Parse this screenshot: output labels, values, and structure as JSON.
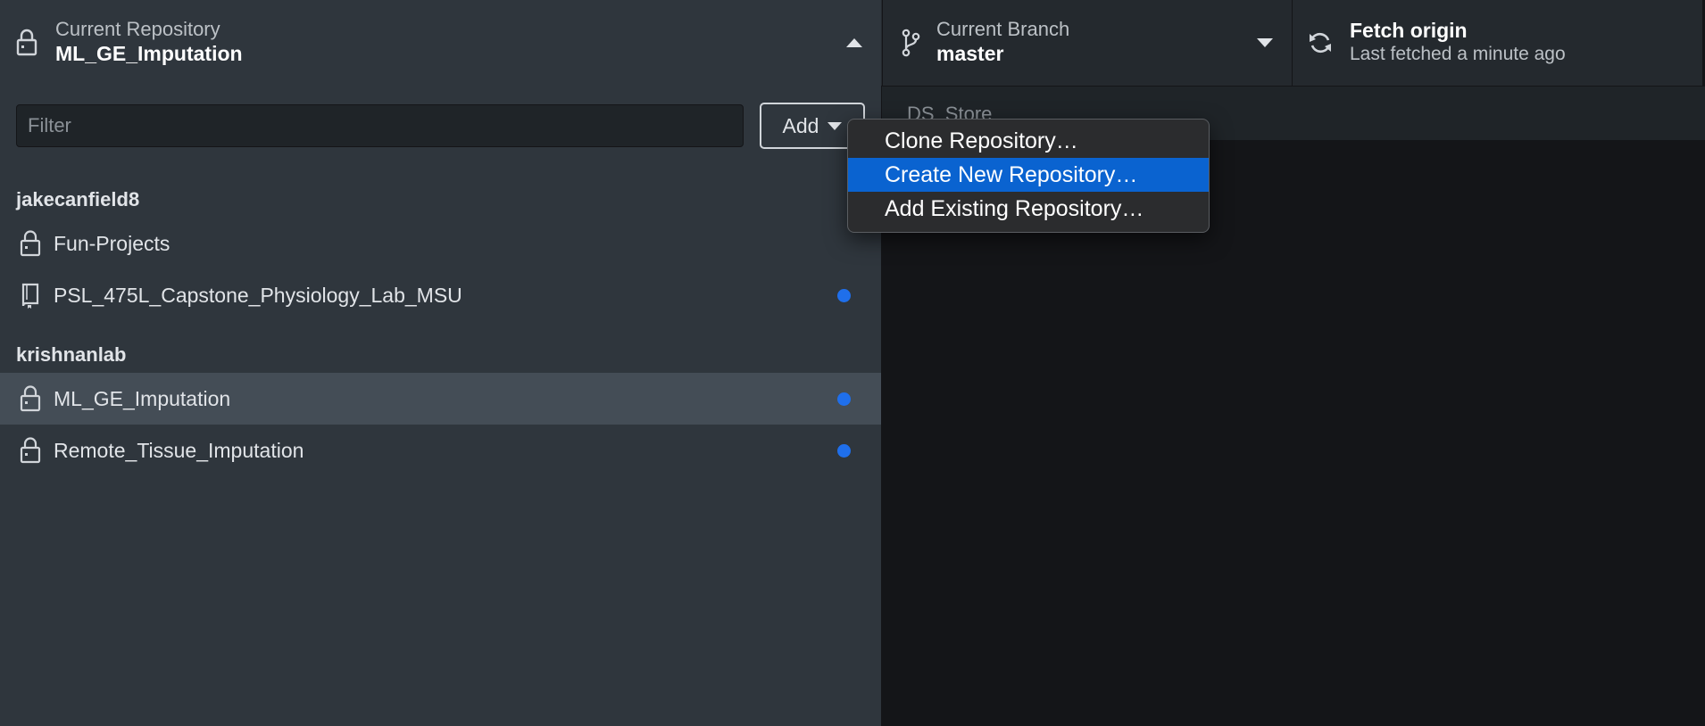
{
  "toolbar": {
    "repository": {
      "label": "Current Repository",
      "value": "ML_GE_Imputation",
      "icon": "lock-icon",
      "toggle_icon": "chevron-up-icon"
    },
    "branch": {
      "label": "Current Branch",
      "value": "master",
      "icon": "git-branch-icon",
      "toggle_icon": "caret-down-icon"
    },
    "fetch": {
      "title": "Fetch origin",
      "subtitle": "Last fetched a minute ago",
      "icon": "sync-icon"
    }
  },
  "sidebar": {
    "filter_placeholder": "Filter",
    "filter_value": "",
    "add_label": "Add",
    "groups": [
      {
        "name": "jakecanfield8",
        "repos": [
          {
            "name": "Fun-Projects",
            "icon": "lock-icon",
            "has_changes": false,
            "selected": false
          },
          {
            "name": "PSL_475L_Capstone_Physiology_Lab_MSU",
            "icon": "repo-book-icon",
            "has_changes": true,
            "selected": false
          }
        ]
      },
      {
        "name": "krishnanlab",
        "repos": [
          {
            "name": "ML_GE_Imputation",
            "icon": "lock-icon",
            "has_changes": true,
            "selected": true
          },
          {
            "name": "Remote_Tissue_Imputation",
            "icon": "lock-icon",
            "has_changes": true,
            "selected": false
          }
        ]
      }
    ]
  },
  "main": {
    "changes_header": "DS_Store"
  },
  "add_menu": {
    "items": [
      {
        "label": "Clone Repository…",
        "highlighted": false
      },
      {
        "label": "Create New Repository…",
        "highlighted": true
      },
      {
        "label": "Add Existing Repository…",
        "highlighted": false
      }
    ]
  },
  "colors": {
    "selected_row": "#444d56",
    "change_dot": "#1f6feb",
    "menu_highlight": "#0a63d0"
  }
}
